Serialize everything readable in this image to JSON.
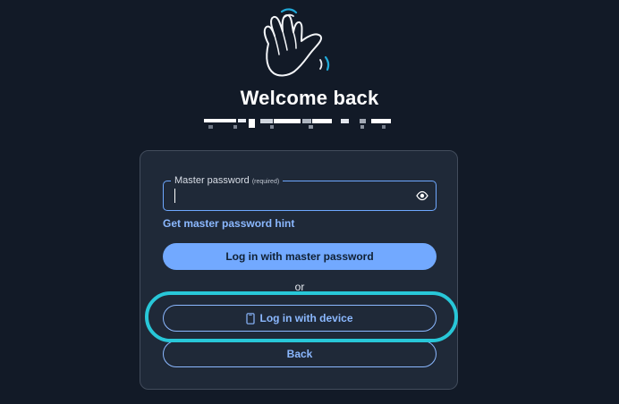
{
  "header": {
    "title": "Welcome back",
    "hero_icon": "waving-hand-icon"
  },
  "form": {
    "password_label": "Master password",
    "password_required": "(required)",
    "password_value": "",
    "visibility_icon": "eye-icon",
    "hint_link": "Get master password hint",
    "primary_button": "Log in with master password",
    "divider_text": "or",
    "device_button": "Log in with device",
    "device_icon": "mobile-device-icon",
    "back_button": "Back"
  },
  "colors": {
    "background": "#121a27",
    "card": "#1f2938",
    "accent": "#72a9ff",
    "focus_ring": "#28c7d8"
  }
}
